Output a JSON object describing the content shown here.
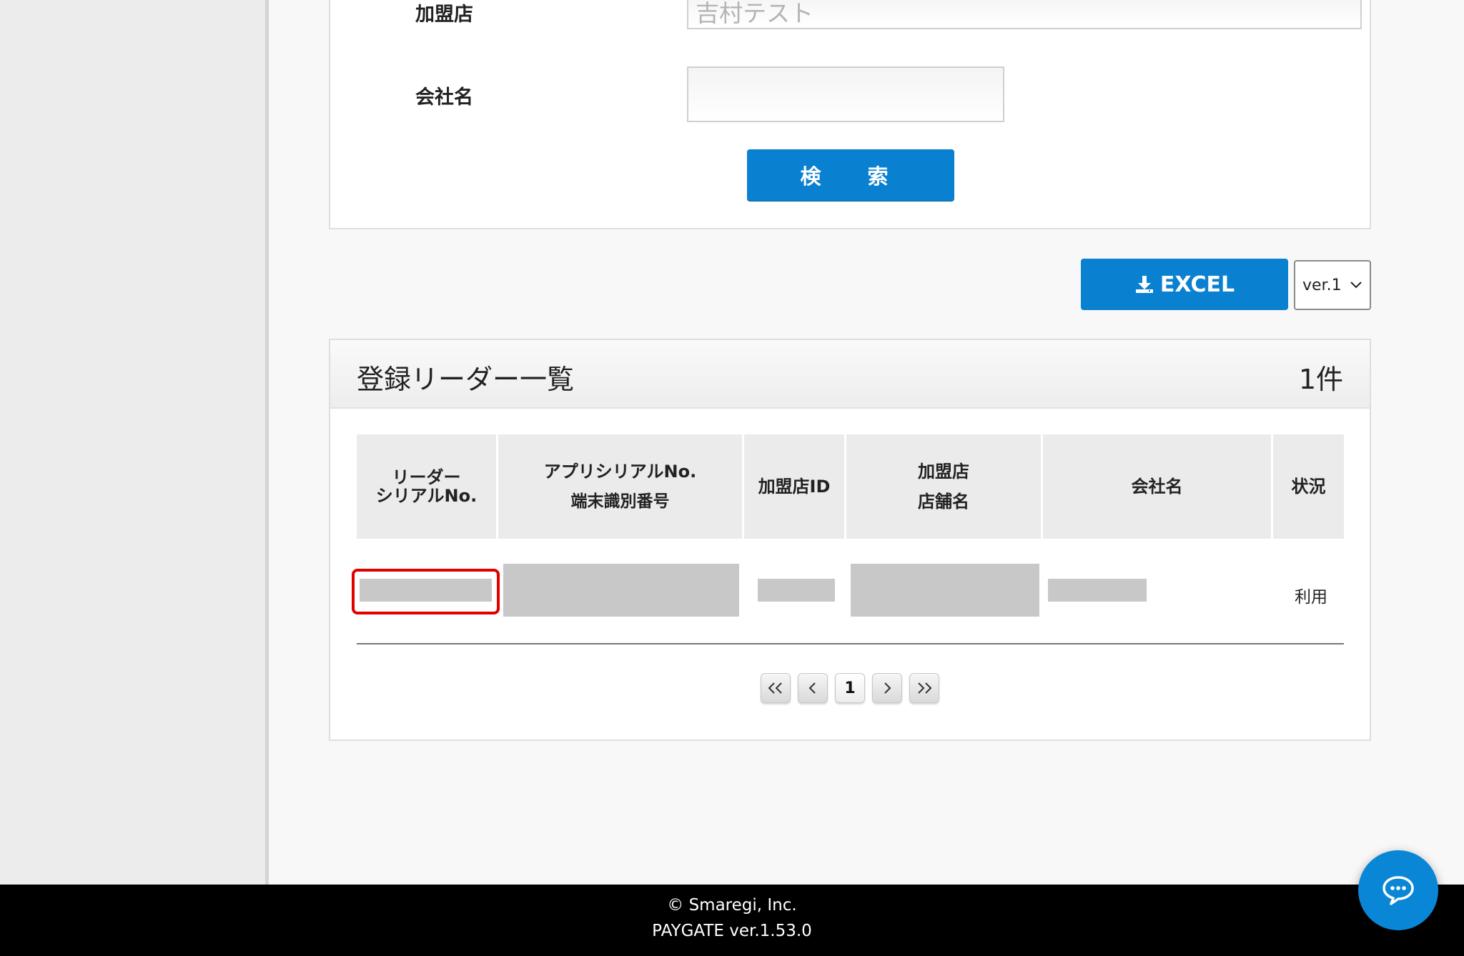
{
  "search": {
    "merchant_label": "加盟店",
    "merchant_value": "吉村テスト",
    "company_label": "会社名",
    "company_value": "",
    "search_button": "検　索"
  },
  "toolbar": {
    "excel_label": "EXCEL",
    "version_value": "ver.1"
  },
  "list": {
    "title": "登録リーダー一覧",
    "count": "1件",
    "columns": [
      {
        "line1": "リーダー",
        "line2": "シリアルNo."
      },
      {
        "line1": "アプリシリアルNo.",
        "line2": "端末識別番号"
      },
      {
        "line1": "加盟店ID",
        "line2": ""
      },
      {
        "line1": "加盟店",
        "line2": "店舗名"
      },
      {
        "line1": "会社名",
        "line2": ""
      },
      {
        "line1": "状況",
        "line2": ""
      }
    ],
    "rows": [
      {
        "status": "利用"
      }
    ]
  },
  "pagination": {
    "first": "<<",
    "prev": "<",
    "current": "1",
    "next": ">",
    "last": ">>"
  },
  "footer": {
    "copyright": "© Smaregi, Inc.",
    "version": "PAYGATE ver.1.53.0"
  },
  "colors": {
    "accent": "#0a80d0",
    "highlight": "#e00000"
  }
}
